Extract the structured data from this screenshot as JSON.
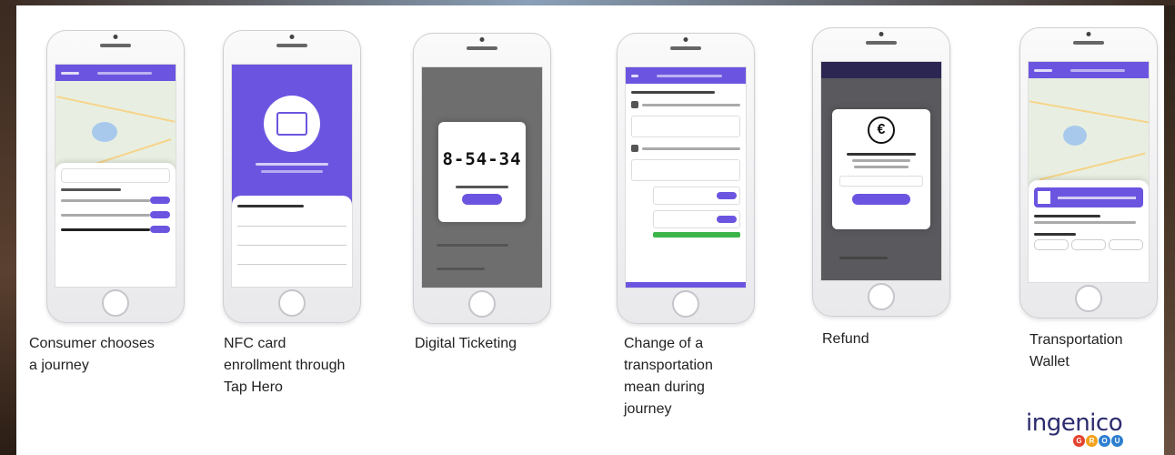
{
  "slide": {
    "screens": [
      {
        "caption": "Consumer chooses\na journey"
      },
      {
        "caption": "NFC card\nenrollment  through\nTap Hero"
      },
      {
        "caption": "Digital Ticketing",
        "ticket_code": "8-54-34"
      },
      {
        "caption": "Change  of a\ntransportation\nmean during\njourney"
      },
      {
        "caption": "Refund",
        "refund_icon": "€"
      },
      {
        "caption": "Transportation\nWallet"
      }
    ],
    "logo": {
      "name": "ingenico",
      "badge_letters": [
        "G",
        "R",
        "O",
        "U"
      ],
      "badge_colors": [
        "#e4422d",
        "#f3a21b",
        "#2e7fd0",
        "#2e7fd0"
      ]
    },
    "colors": {
      "accent": "#6b55e0",
      "map_green": "#e8efe2"
    },
    "icons": [
      "menu-icon",
      "nfc-card-icon",
      "euro-icon",
      "train-icon",
      "bus-icon",
      "ticket-qr-icon"
    ]
  }
}
